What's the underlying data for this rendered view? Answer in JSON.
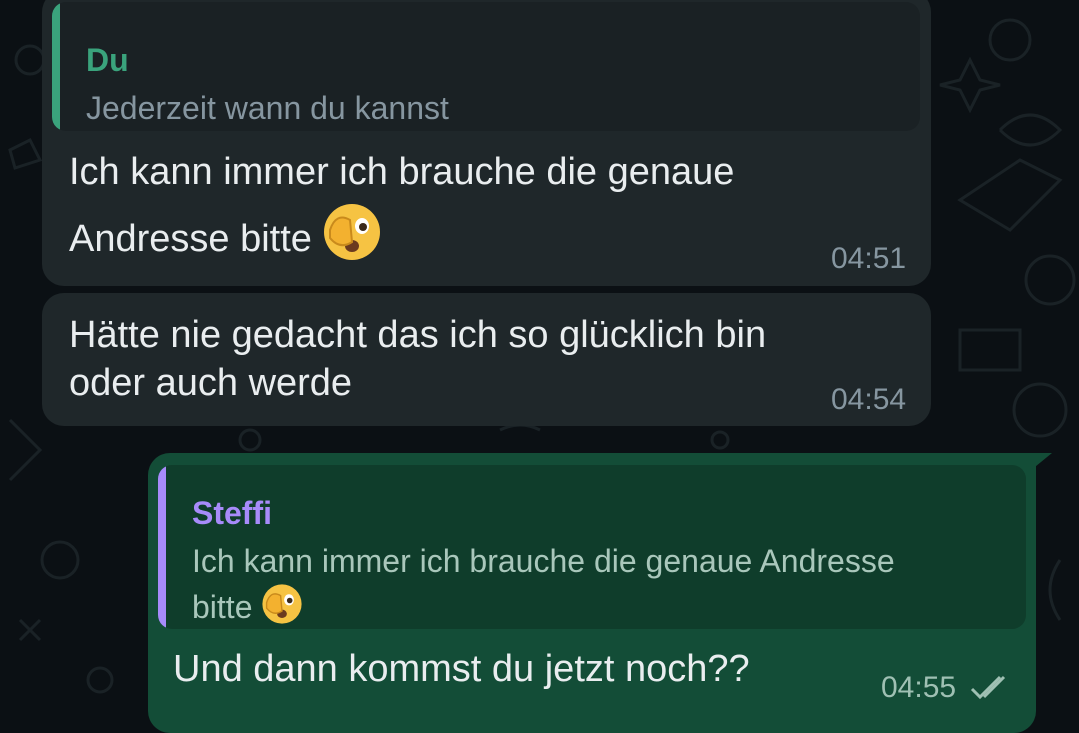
{
  "colors": {
    "background": "#0b1014",
    "incoming_bubble": "#1f272a",
    "outgoing_bubble": "#134d37",
    "quote_author_du": "#3aa37c",
    "quote_author_steffi": "#a78bfa",
    "text": "#e9edef",
    "meta": "#8696a0"
  },
  "messages": [
    {
      "quote": {
        "author": "Du",
        "text": "Jederzeit wann du kannst"
      },
      "line1": "Ich kann immer ich brauche die genaue",
      "line2": "Andresse bitte",
      "emoji": "face-with-hand-over-mouth-peeking",
      "time": "04:51"
    },
    {
      "line1": "Hätte nie gedacht das ich so glücklich bin",
      "line2": "oder auch werde",
      "time": "04:54"
    },
    {
      "quote": {
        "author": "Steffi",
        "text_line1": "Ich kann immer ich brauche die genaue Andresse",
        "text_line2": "bitte",
        "emoji": "face-with-hand-over-mouth-peeking"
      },
      "text": "Und dann kommst du jetzt noch??",
      "time": "04:55",
      "status_icon": "double-check-icon"
    }
  ]
}
